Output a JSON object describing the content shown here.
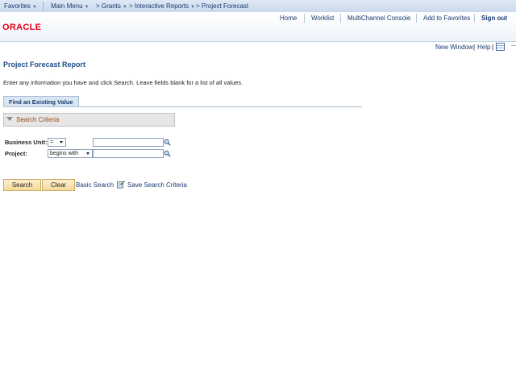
{
  "menubar": {
    "favorites": "Favorites",
    "main_menu": "Main Menu",
    "crumb1": "> Grants",
    "crumb2": "> Interactive Reports",
    "crumb3": "> Project Forecast"
  },
  "header": {
    "logo": "ORACLE",
    "home": "Home",
    "worklist": "Worklist",
    "multichannel": "MultiChannel Console",
    "add_favorites": "Add to Favorites",
    "sign_out": "Sign out"
  },
  "toplinks": {
    "new_window": "New Window",
    "sep": "|",
    "help": "Help",
    "sep2": "|"
  },
  "page": {
    "title": "Project Forecast Report",
    "instructions": "Enter any information you have and click Search. Leave fields blank for a list of all values.",
    "tab": "Find an Existing Value",
    "criteria": "Search Criteria"
  },
  "form": {
    "business_unit_label": "Business Unit:",
    "business_unit_op": "=",
    "business_unit_value": "",
    "project_label": "Project:",
    "project_op": "begins with",
    "project_value": ""
  },
  "actions": {
    "search": "Search",
    "clear": "Clear",
    "basic_search": "Basic Search",
    "save_criteria": "Save Search Criteria"
  }
}
